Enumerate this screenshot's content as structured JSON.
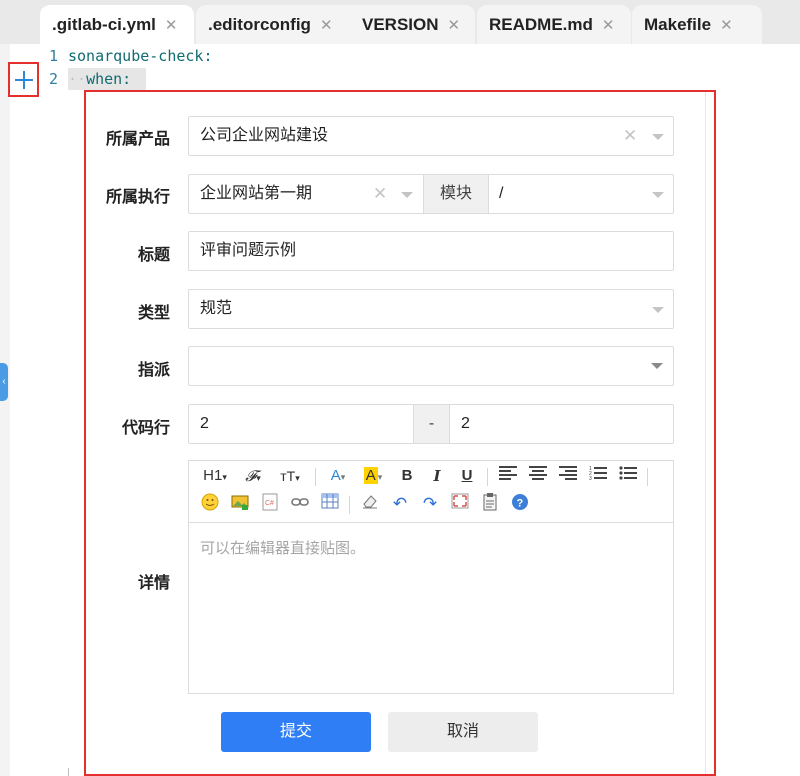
{
  "tabs": [
    {
      "label": ".gitlab-ci.yml",
      "close": "✕",
      "active": true
    },
    {
      "label": ".editorconfig",
      "close": "✕"
    },
    {
      "label": "VERSION",
      "close": "✕"
    },
    {
      "label": "README.md",
      "close": "✕"
    },
    {
      "label": "Makefile",
      "close": "✕"
    }
  ],
  "editor": {
    "lines": [
      {
        "num": "1",
        "text": "sonarqube-check:"
      },
      {
        "num": "2",
        "indent": "··",
        "text": "when:"
      }
    ]
  },
  "form": {
    "product": {
      "label": "所属产品",
      "value": "公司企业网站建设",
      "clear": "✕"
    },
    "execution": {
      "label": "所属执行",
      "value": "企业网站第一期",
      "clear": "✕",
      "module_label": "模块",
      "module_value": "/"
    },
    "title": {
      "label": "标题",
      "value": "评审问题示例"
    },
    "type": {
      "label": "类型",
      "value": "规范"
    },
    "assign": {
      "label": "指派",
      "value": ""
    },
    "codeline": {
      "label": "代码行",
      "from": "2",
      "sep": "-",
      "to": "2"
    },
    "detail": {
      "label": "详情",
      "placeholder": "可以在编辑器直接贴图。"
    },
    "toolbar": {
      "h1": "H1",
      "bold": "B",
      "italic": "I",
      "underline": "U"
    },
    "submit": "提交",
    "cancel": "取消"
  },
  "colors": {
    "accent": "#2f7ef6",
    "highlight_border": "#e3302c",
    "link_blue": "#2b88d8"
  }
}
